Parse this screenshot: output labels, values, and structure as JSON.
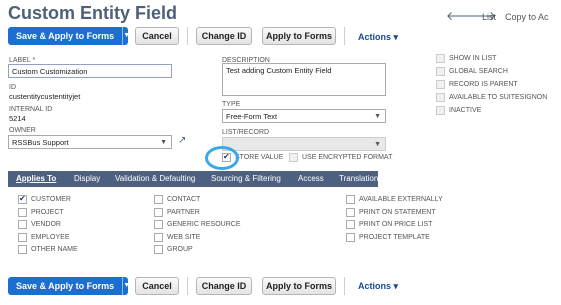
{
  "header": {
    "title": "Custom Entity Field",
    "nav_list": "List",
    "nav_copy": "Copy to Ac"
  },
  "toolbar": {
    "save_apply": "Save & Apply to Forms",
    "cancel": "Cancel",
    "change_id": "Change ID",
    "apply_forms": "Apply to Forms",
    "actions": "Actions ▾"
  },
  "form": {
    "label_label": "LABEL *",
    "label_value": "Custom Customization",
    "id_label": "ID",
    "id_value": "custentitycustentityjet",
    "internal_id_label": "INTERNAL ID",
    "internal_id_value": "5214",
    "owner_label": "OWNER",
    "owner_value": "RSSBus Support",
    "description_label": "DESCRIPTION",
    "description_value": "Test adding Custom Entity Field",
    "type_label": "TYPE",
    "type_value": "Free-Form Text",
    "list_record_label": "LIST/RECORD",
    "list_record_value": "",
    "store_value_label": "STORE VALUE",
    "use_encrypted_label": "USE ENCRYPTED FORMAT"
  },
  "right_options": [
    {
      "label": "SHOW IN LIST",
      "checked": false
    },
    {
      "label": "GLOBAL SEARCH",
      "checked": false
    },
    {
      "label": "RECORD IS PARENT",
      "checked": false
    },
    {
      "label": "AVAILABLE TO SUITESIGNON",
      "checked": false
    },
    {
      "label": "INACTIVE",
      "checked": false
    }
  ],
  "tabs": [
    "Applies To",
    "Display",
    "Validation & Defaulting",
    "Sourcing & Filtering",
    "Access",
    "Translation",
    "History"
  ],
  "applies_col1": [
    {
      "label": "CUSTOMER",
      "checked": true
    },
    {
      "label": "PROJECT",
      "checked": false
    },
    {
      "label": "VENDOR",
      "checked": false
    },
    {
      "label": "EMPLOYEE",
      "checked": false
    },
    {
      "label": "OTHER NAME",
      "checked": false
    }
  ],
  "applies_col2": [
    {
      "label": "CONTACT",
      "checked": false
    },
    {
      "label": "PARTNER",
      "checked": false
    },
    {
      "label": "GENERIC RESOURCE",
      "checked": false
    },
    {
      "label": "WEB SITE",
      "checked": false
    },
    {
      "label": "GROUP",
      "checked": false
    }
  ],
  "applies_col3": [
    {
      "label": "AVAILABLE EXTERNALLY",
      "checked": false
    },
    {
      "label": "PRINT ON STATEMENT",
      "checked": false
    },
    {
      "label": "PRINT ON PRICE LIST",
      "checked": false
    },
    {
      "label": "PROJECT TEMPLATE",
      "checked": false
    }
  ],
  "colors": {
    "primary": "#1a6fd1",
    "tabbar": "#4d6080",
    "title": "#4d5f79",
    "annotation": "#3aa7e8"
  }
}
